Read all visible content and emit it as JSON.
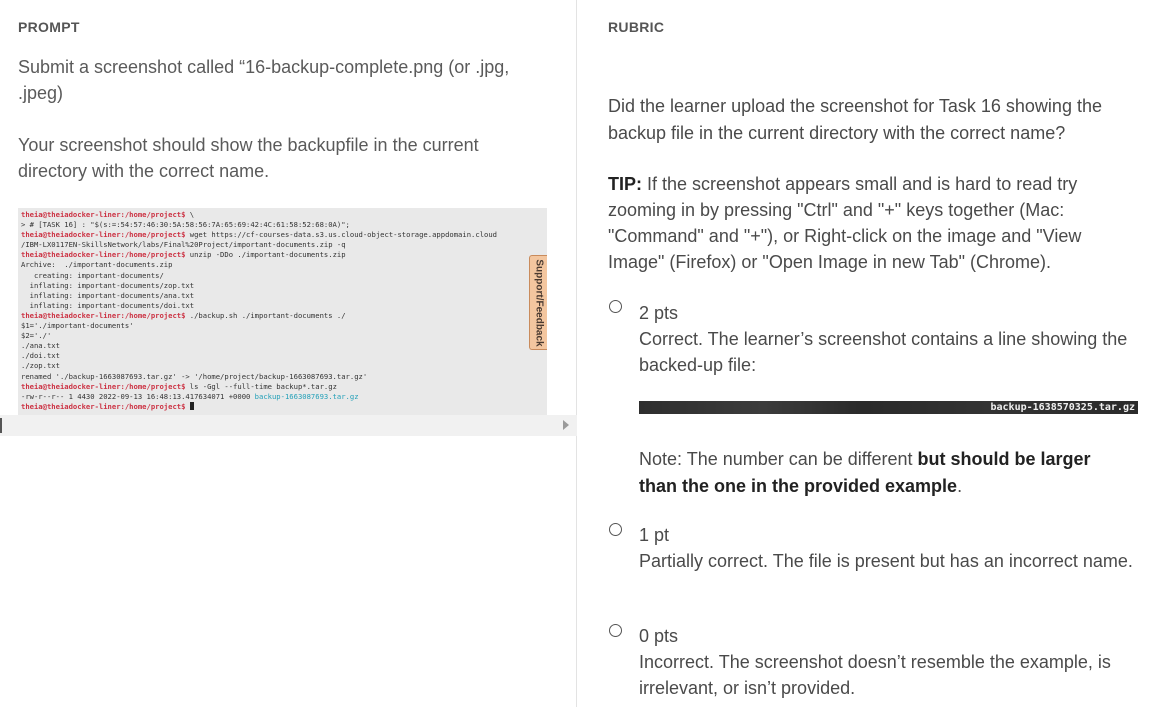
{
  "prompt": {
    "heading": "PROMPT",
    "paragraph1": "Submit a screenshot called “16-backup-complete.png (or .jpg, .jpeg)",
    "paragraph2": "Your screenshot should show the backupfile in the current directory with the correct name.",
    "terminal_lines": [
      [
        {
          "t": "theia@theiadocker-liner:/home/project$",
          "c": "red"
        },
        {
          "t": " \\",
          "c": ""
        }
      ],
      [
        {
          "t": "> # [TASK 16] : \"$(s:=:54:57:46:30:5A:58:56:7A:65:69:42:4C:61:58:52:68:0A)\";",
          "c": ""
        }
      ],
      [
        {
          "t": "theia@theiadocker-liner:/home/project$",
          "c": "red"
        },
        {
          "t": " wget https://cf-courses-data.s3.us.cloud-object-storage.appdomain.cloud",
          "c": ""
        }
      ],
      [
        {
          "t": "/IBM-LX0117EN-SkillsNetwork/labs/Final%20Project/important-documents.zip -q",
          "c": ""
        }
      ],
      [
        {
          "t": "theia@theiadocker-liner:/home/project$",
          "c": "red"
        },
        {
          "t": " unzip -DDo ./important-documents.zip",
          "c": ""
        }
      ],
      [
        {
          "t": "Archive:  ./important-documents.zip",
          "c": ""
        }
      ],
      [
        {
          "t": "   creating: important-documents/",
          "c": ""
        }
      ],
      [
        {
          "t": "  inflating: important-documents/zop.txt",
          "c": ""
        }
      ],
      [
        {
          "t": "  inflating: important-documents/ana.txt",
          "c": ""
        }
      ],
      [
        {
          "t": "  inflating: important-documents/doi.txt",
          "c": ""
        }
      ],
      [
        {
          "t": "theia@theiadocker-liner:/home/project$",
          "c": "red"
        },
        {
          "t": " ./backup.sh ./important-documents ./",
          "c": ""
        }
      ],
      [
        {
          "t": "$1='./important-documents'",
          "c": ""
        }
      ],
      [
        {
          "t": "$2='./'",
          "c": ""
        }
      ],
      [
        {
          "t": "./ana.txt",
          "c": ""
        }
      ],
      [
        {
          "t": "./doi.txt",
          "c": ""
        }
      ],
      [
        {
          "t": "./zop.txt",
          "c": ""
        }
      ],
      [
        {
          "t": "renamed './backup-1663087693.tar.gz' -> '/home/project/backup-1663087693.tar.gz'",
          "c": ""
        }
      ],
      [
        {
          "t": "theia@theiadocker-liner:/home/project$",
          "c": "red"
        },
        {
          "t": " ls -Ggl --full-time backup*.tar.gz",
          "c": ""
        }
      ],
      [
        {
          "t": "-rw-r--r-- 1 4430 2022-09-13 16:48:13.417634071 +0000 ",
          "c": ""
        },
        {
          "t": "backup-1663087693.tar.gz",
          "c": "cyan"
        }
      ],
      [
        {
          "t": "theia@theiadocker-liner:/home/project$",
          "c": "red"
        },
        {
          "t": " ",
          "c": ""
        },
        {
          "t": "",
          "c": "cursor"
        }
      ]
    ],
    "support_tab": "Support/Feedback"
  },
  "rubric": {
    "heading": "RUBRIC",
    "question": "Did the learner upload the screenshot for Task 16 showing the backup file in the current directory with the correct name?",
    "tip_label": "TIP:",
    "tip_text": " If the screenshot appears small and is hard to read try zooming in by pressing \"Ctrl\" and \"+\" keys together (Mac: \"Command\" and \"+\"), or Right-click on the image and \"View Image\" (Firefox) or \"Open Image in new Tab\" (Chrome).",
    "options": [
      {
        "points": "2 pts",
        "description": "Correct. The learner’s screenshot contains a line showing the backed-up file:"
      },
      {
        "points": "1 pt",
        "description": "Partially correct. The file is present but has an incorrect name."
      },
      {
        "points": "0 pts",
        "description": "Incorrect. The screenshot doesn’t resemble the example, is irrelevant, or isn’t provided."
      }
    ],
    "example_filename": "backup-1638570325.tar.gz",
    "note_text": "Note: The number can be different ",
    "note_bold": "but should be larger than the one in the provided example",
    "note_end": "."
  }
}
